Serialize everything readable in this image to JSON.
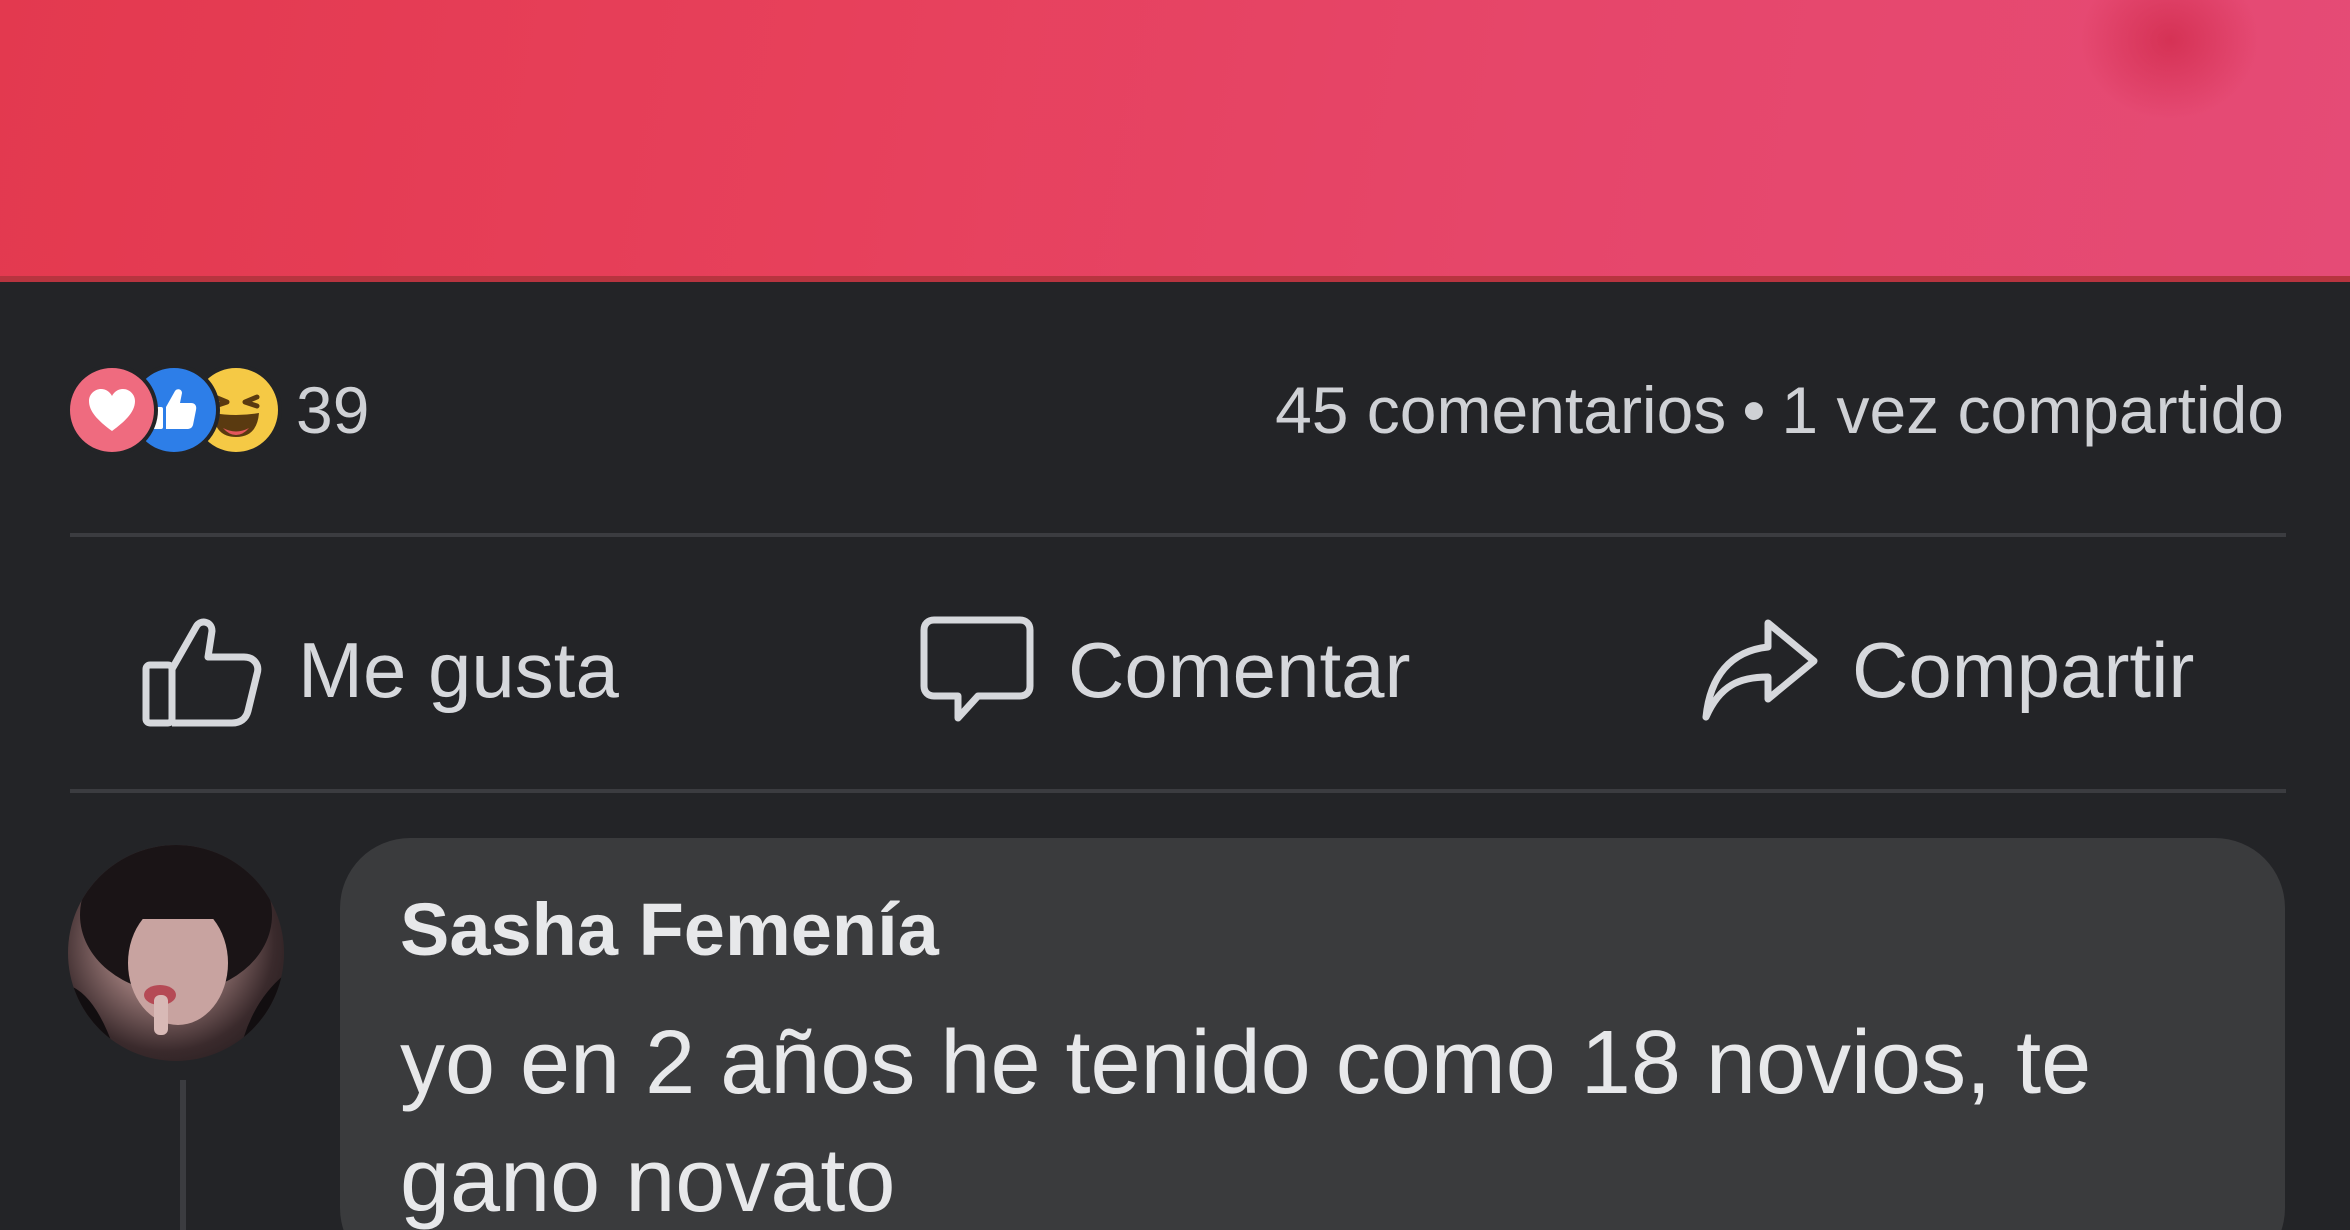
{
  "post": {
    "image": {
      "colors": [
        "#e3394f",
        "#e54b76"
      ]
    },
    "reactions": {
      "types": [
        "love-icon",
        "like-icon",
        "haha-icon"
      ],
      "count": "39"
    },
    "stats": {
      "comments": "45 comentarios",
      "separator": "•",
      "shares": "1 vez compartido"
    },
    "actions": {
      "like_label": "Me gusta",
      "comment_label": "Comentar",
      "share_label": "Compartir"
    }
  },
  "comment": {
    "author": "Sasha Femenía",
    "text": "yo en 2 años he tenido como 18 novios, te gano novato"
  },
  "theme": {
    "background": "#232427",
    "bubble": "#3a3b3d",
    "text": "#e7e8ea",
    "muted_text": "#cfd1d5"
  }
}
